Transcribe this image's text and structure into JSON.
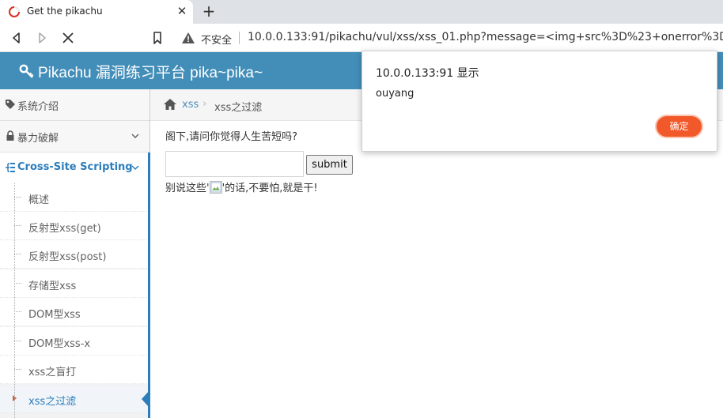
{
  "browser": {
    "tab_title": "Get the pikachu",
    "tab_close_glyph": "✕",
    "new_tab_glyph": "+",
    "security_label": "不安全",
    "url": "10.0.0.133:91/pikachu/vul/xss/xss_01.php?message=<img+src%3D%23+onerror%3D\"aler"
  },
  "header": {
    "title": "Pikachu 漏洞练习平台 pika~pika~",
    "color": "#438eb9"
  },
  "sidebar": {
    "top_items": [
      {
        "label": "系统介绍",
        "icon": "tag-icon"
      },
      {
        "label": "暴力破解",
        "icon": "lock-icon"
      },
      {
        "label": "Cross-Site Scripting",
        "icon": "sitemap-icon"
      }
    ],
    "sub_items": [
      {
        "label": "概述"
      },
      {
        "label": "反射型xss(get)"
      },
      {
        "label": "反射型xss(post)"
      },
      {
        "label": "存储型xss"
      },
      {
        "label": "DOM型xss"
      },
      {
        "label": "DOM型xss-x"
      },
      {
        "label": "xss之盲打"
      },
      {
        "label": "xss之过滤"
      }
    ]
  },
  "breadcrumb": {
    "link": "xss",
    "separator": "›",
    "current": "xss之过滤"
  },
  "content": {
    "question": "阁下,请问你觉得人生苦短吗?",
    "input_value": "",
    "submit_label": "submit",
    "result_before": "别说这些'",
    "result_after": "'的话,不要怕,就是干!"
  },
  "dialog": {
    "title": "10.0.0.133:91 显示",
    "message": "ouyang",
    "ok_label": "确定",
    "ok_color": "#f2592a"
  }
}
